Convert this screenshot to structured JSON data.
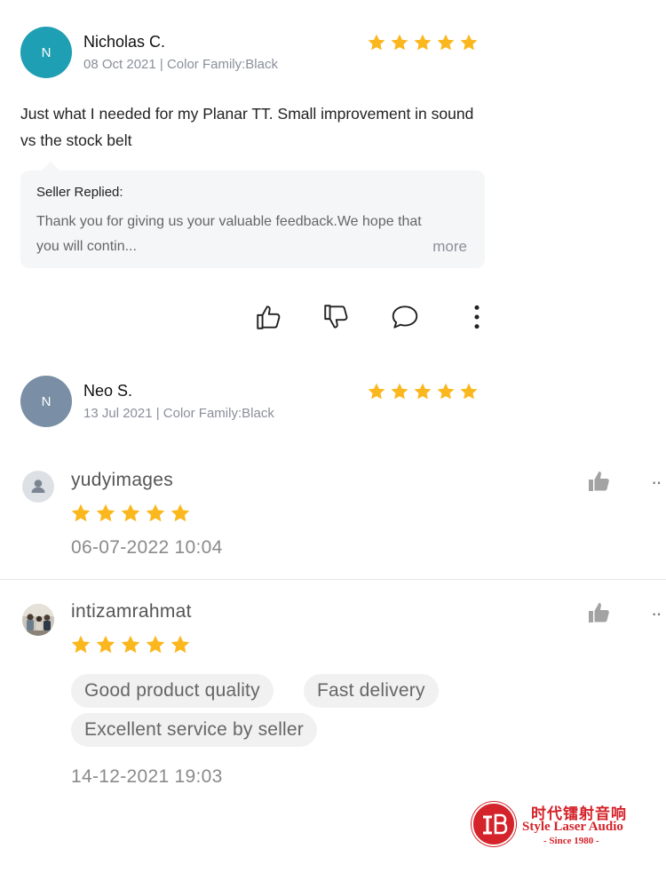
{
  "reviews": [
    {
      "avatar_letter": "N",
      "avatar_color": "#1f9fb3",
      "name": "Nicholas C.",
      "meta": "08 Oct 2021 | Color Family:Black",
      "rating": 5,
      "text": "Just what I needed for my Planar TT. Small improvement in sound vs the stock belt",
      "seller_reply": {
        "title": "Seller Replied:",
        "body": "Thank you for giving us your valuable feedback.We hope that you will contin...",
        "more_label": "more"
      },
      "actions": [
        "thumbs-up-icon",
        "thumbs-down-icon",
        "comment-icon",
        "more-vertical-icon"
      ]
    },
    {
      "avatar_letter": "N",
      "avatar_color": "#7a8fa6",
      "name": "Neo S.",
      "meta": "13 Jul 2021 | Color Family:Black",
      "rating": 5
    }
  ],
  "user_reviews": [
    {
      "username": "yudyimages",
      "rating": 5,
      "date": "06-07-2022 10:04",
      "avatar": "default-user-icon"
    },
    {
      "username": "intizamrahmat",
      "rating": 5,
      "tags": [
        "Good product quality",
        "Fast delivery",
        "Excellent service by seller"
      ],
      "date": "14-12-2021 19:03",
      "avatar": "photo-avatar"
    }
  ],
  "watermark": {
    "chinese": "时代镭射音响",
    "english": "Style Laser Audio",
    "since": "- Since 1980 -"
  },
  "colors": {
    "star": "#fbb71e",
    "brand_red": "#d4232a"
  }
}
